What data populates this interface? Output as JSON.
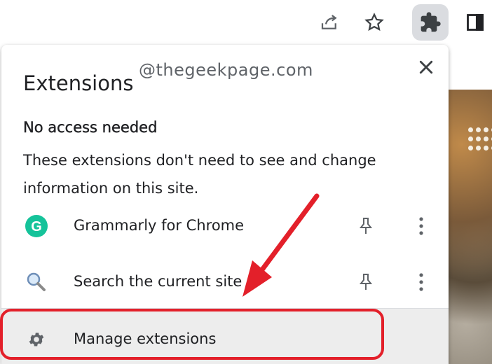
{
  "toolbar": {
    "icons": [
      "share-icon",
      "star-icon",
      "puzzle-extensions-icon",
      "side-panel-icon"
    ]
  },
  "watermark": "@thegeekpage.com",
  "popup": {
    "title": "Extensions",
    "close_icon": "close-icon",
    "section": {
      "heading": "No access needed",
      "description": "These extensions don't need to see and change information on this site."
    },
    "extensions": [
      {
        "name": "Grammarly for Chrome",
        "icon": "grammarly-icon",
        "icon_letter": "G",
        "icon_color": "#15c39a"
      },
      {
        "name": "Search the current site",
        "icon": "magnifier-icon"
      }
    ],
    "manage": {
      "label": "Manage extensions",
      "icon": "gear-icon"
    }
  },
  "colors": {
    "annotation_red": "#e3202a",
    "manage_row_bg": "#ededed",
    "text": "#202124"
  }
}
